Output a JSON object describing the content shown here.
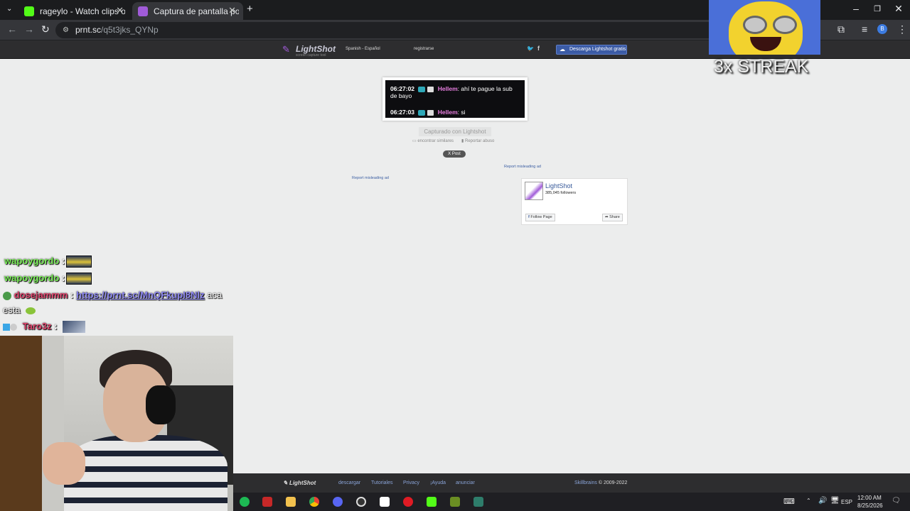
{
  "browser": {
    "tabs": [
      {
        "title": "rageylo - Watch clips on Kick",
        "active": false,
        "favicon_color": "#53fc18"
      },
      {
        "title": "Captura de pantalla por Lightshot",
        "active": true,
        "favicon_color": "#a05bd8"
      }
    ],
    "new_tab": "+",
    "address": {
      "domain": "prnt.sc",
      "path": "/q5t3jks_QYNp"
    }
  },
  "lightshot": {
    "logo": "LightShot",
    "tagline": "screen capture tool",
    "language": "Spanish - Español",
    "register": "registrarse",
    "download_button": "Descarga Lightshot gratis",
    "screenshot_chat": [
      {
        "time": "06:27:02",
        "user": "Hellem",
        "message": ": ahí te pague la sub de bayo"
      },
      {
        "time": "06:27:03",
        "user": "Hellem",
        "message": ": si"
      }
    ],
    "captured_label": "Capturado con Lightshot",
    "find_similar": "encontrar similares",
    "report_abuse": "Reportar abuso",
    "x_post": "X Post",
    "report_ad_1": "Report misleading ad",
    "report_ad_2": "Report misleading ad",
    "fb": {
      "name": "LightShot",
      "followers": "385,045 followers",
      "follow": "Follow Page",
      "share": "Share"
    },
    "footer": {
      "logo": "LightShot",
      "links": [
        "descargar",
        "Tutoriales",
        "Privacy",
        "¡Ayuda",
        "anunciar"
      ],
      "copyright_link": "Skillbrains",
      "copyright": " © 2009-2022"
    }
  },
  "overlay": {
    "streak": "3x STREAK",
    "chat": [
      {
        "user": "wapoygordo",
        "sep": " :",
        "user_color": "#7cf05a"
      },
      {
        "user": "wapoygordo",
        "sep": " :",
        "user_color": "#7cf05a"
      },
      {
        "user": "dosejammm",
        "sep": " :",
        "link": "https://prnt.sc/MnQFkupI8Nlz",
        "after": " aca",
        "user_color": "#e0466e"
      },
      {
        "text": "esta"
      },
      {
        "user": "Taro3z",
        "sep": " :",
        "user_color": "#e0466e"
      }
    ]
  },
  "taskbar": {
    "language": "ESP",
    "time": "12:00 AM",
    "date": "8/25/2026"
  }
}
